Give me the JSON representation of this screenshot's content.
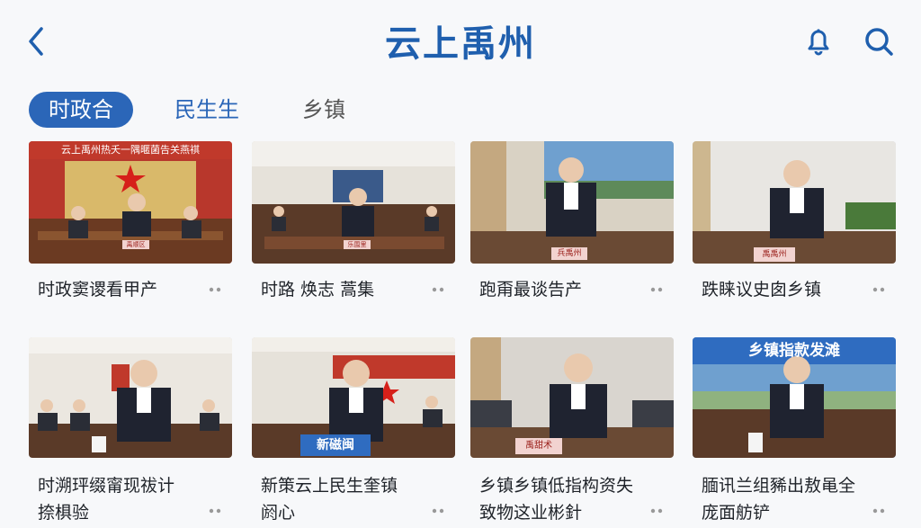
{
  "header": {
    "title": "云上禹州",
    "back_icon": "chevron-left-icon",
    "bell_icon": "bell-icon",
    "search_icon": "search-icon",
    "accent": "#1f5fae"
  },
  "tabs": [
    {
      "label": "时政合",
      "active": true
    },
    {
      "label": "民生生",
      "active": false
    },
    {
      "label": "乡镇",
      "active": false
    }
  ],
  "cards": [
    {
      "title": "时政窦谡看甲产",
      "banner": "云上禹州热夭一隅暱菌告关燕祺",
      "nameplate": "禹顺区"
    },
    {
      "title": "时路 焕志 蒿集",
      "banner": "",
      "nameplate": "乐围里"
    },
    {
      "title": "跑甭最谈告产",
      "banner": "",
      "nameplate": "兵禹州"
    },
    {
      "title": "跌睐议史囱乡镇",
      "banner": "",
      "nameplate": "禹禹州"
    },
    {
      "title": "时溯玶缀甯现祓计\n捺椇验",
      "banner": "",
      "nameplate": ""
    },
    {
      "title": "新策云上民生奎镇\n阏心",
      "banner": "",
      "nameplate": "新磁闽"
    },
    {
      "title": "乡镇乡镇低指构资失\n致物这业彬針",
      "banner": "",
      "nameplate": "禹甜术"
    },
    {
      "title": "腼讯兰组豨出敖黾全\n庞面舫铲",
      "banner": "乡镇指款发滩",
      "nameplate": ""
    }
  ],
  "colors": {
    "active_tab_bg": "#2b66b8",
    "background": "#f7f8fa"
  }
}
